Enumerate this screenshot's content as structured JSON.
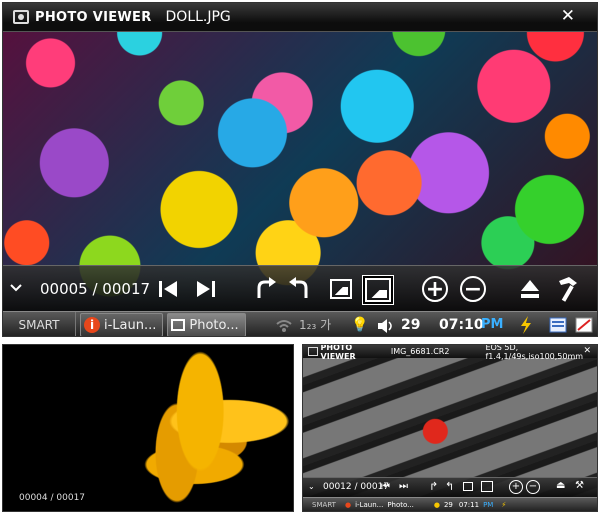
{
  "main": {
    "app_title": "PHOTO VIEWER",
    "file_name": "DOLL.JPG",
    "close_glyph": "✕",
    "counter": "00005 / 00017",
    "taskbar": {
      "start": "SMART",
      "app1_label": "i-Laun...",
      "app2_label": "Photo...",
      "status_text": "1₂₃ 가",
      "volume": "29",
      "time": "07:10",
      "ampm": "PM"
    }
  },
  "small_left": {
    "counter": "00004 / 00017"
  },
  "small_right": {
    "app_title": "PHOTO VIEWER",
    "file_name": "IMG_6681.CR2",
    "exif": "EOS 5D, f1.4,1/49s,iso100,50mm",
    "close_glyph": "✕",
    "counter": "00012 / 00017",
    "app1_label": "i-Laun...",
    "app2_label": "Photo...",
    "volume": "29",
    "time": "07:11",
    "ampm": "PM"
  },
  "colors": {
    "accent_blue": "#3ab0ff",
    "lightning": "#f7c600"
  },
  "icons": [
    "chevron-down-icon",
    "skip-previous-icon",
    "skip-next-icon",
    "rotate-right-icon",
    "rotate-left-icon",
    "picture-fit-icon",
    "picture-full-icon",
    "zoom-in-icon",
    "zoom-out-icon",
    "eject-icon",
    "hammer-icon",
    "wifi-icon",
    "bulb-icon",
    "speaker-icon",
    "lightning-icon",
    "keyboard-icon",
    "edit-icon"
  ]
}
